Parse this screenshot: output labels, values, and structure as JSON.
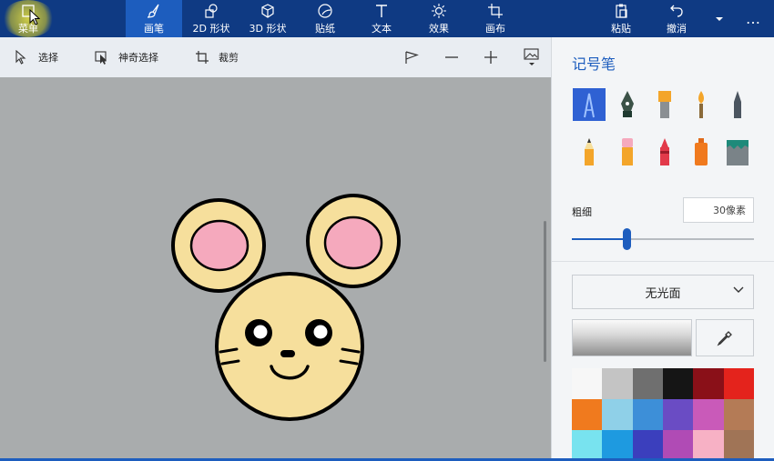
{
  "ribbon": {
    "menu_label": "菜单",
    "tabs": [
      {
        "label": "画笔",
        "icon": "brush-icon",
        "active": true
      },
      {
        "label": "2D 形状",
        "icon": "shapes-2d-icon",
        "active": false
      },
      {
        "label": "3D 形状",
        "icon": "cube-icon",
        "active": false
      },
      {
        "label": "贴纸",
        "icon": "sticker-icon",
        "active": false
      },
      {
        "label": "文本",
        "icon": "text-icon",
        "active": false
      },
      {
        "label": "效果",
        "icon": "effects-icon",
        "active": false
      },
      {
        "label": "画布",
        "icon": "canvas-icon",
        "active": false
      }
    ],
    "paste_label": "粘贴",
    "undo_label": "撤消",
    "more_label": "…"
  },
  "toolbar2": {
    "select_label": "选择",
    "magic_select_label": "神奇选择",
    "crop_label": "裁剪"
  },
  "panel": {
    "title": "记号笔",
    "brushes": [
      "marker-icon",
      "calligraphy-pen-icon",
      "oil-brush-icon",
      "watercolor-icon",
      "pixel-pen-icon",
      "pencil-icon",
      "eraser-icon",
      "crayon-icon",
      "spray-can-icon",
      "fill-icon"
    ],
    "thickness_label": "粗细",
    "thickness_value": "30像素",
    "thickness_fraction": 0.3,
    "finish_label": "无光面",
    "palette": [
      "#f7f7f7",
      "#c4c4c4",
      "#6f6f6f",
      "#151515",
      "#8a1018",
      "#e4231c",
      "#f07a1e",
      "#8fd0e8",
      "#3d8fd8",
      "#6a4cc4",
      "#c95ab9",
      "#b47b56",
      "#78e3ef",
      "#1e9ae0",
      "#3b3fbd",
      "#b04bb5",
      "#f7b1c5",
      "#a07456"
    ]
  },
  "colors": {
    "ribbon_bg": "#0f3a83",
    "accent": "#1d5dbe",
    "canvas_bg": "#a9acad",
    "mouse_face": "#f6df9c",
    "mouse_ear_inner": "#f5a9bd"
  }
}
